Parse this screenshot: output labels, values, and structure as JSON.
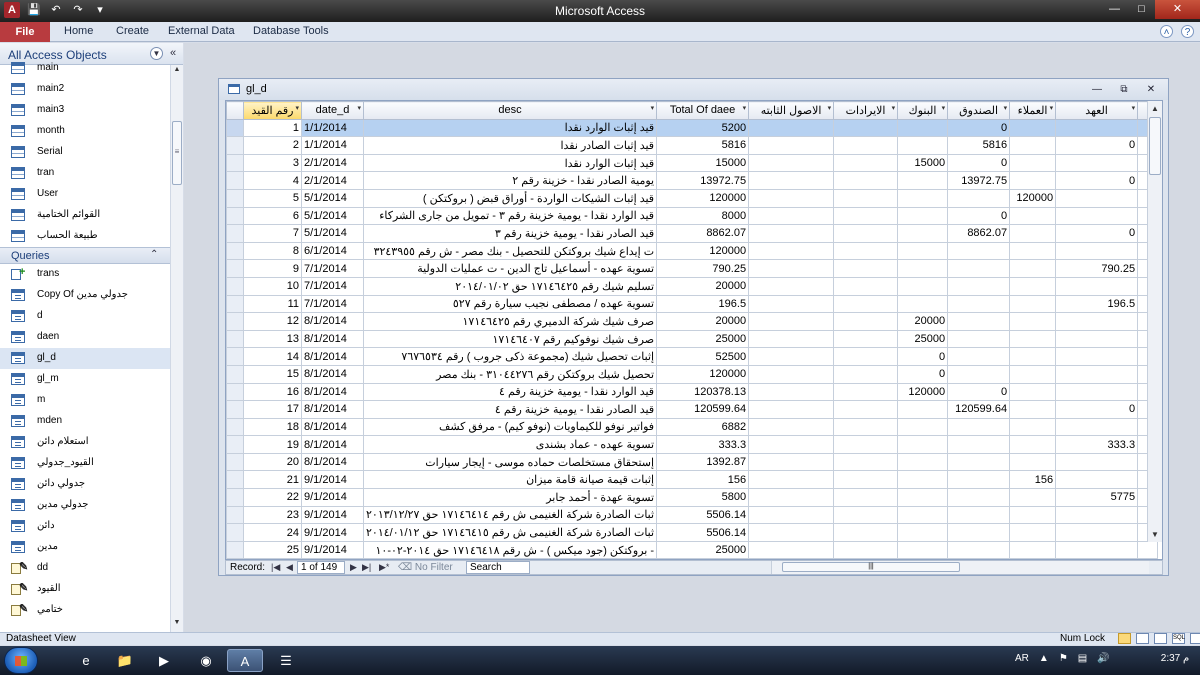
{
  "window": {
    "title": "Microsoft Access"
  },
  "ribbon": {
    "file": "File",
    "tabs": [
      "Home",
      "Create",
      "External Data",
      "Database Tools"
    ]
  },
  "nav": {
    "header": "All Access Objects",
    "tables": [
      "main",
      "main2",
      "main3",
      "month",
      "Serial",
      "tran",
      "User",
      "القوائم الختامية",
      "طبيعة الحساب"
    ],
    "queries_header": "Queries",
    "queries": [
      {
        "label": "trans",
        "kind": "append"
      },
      {
        "label": "Copy Of جدولي مدين",
        "kind": "select"
      },
      {
        "label": "d",
        "kind": "select"
      },
      {
        "label": "daen",
        "kind": "select"
      },
      {
        "label": "gl_d",
        "kind": "select",
        "selected": true
      },
      {
        "label": "gl_m",
        "kind": "select"
      },
      {
        "label": "m",
        "kind": "select"
      },
      {
        "label": "mden",
        "kind": "select"
      },
      {
        "label": "استعلام دائن",
        "kind": "select"
      },
      {
        "label": "القيود_جدولي",
        "kind": "select"
      },
      {
        "label": "جدولي دائن",
        "kind": "select"
      },
      {
        "label": "جدولي مدين",
        "kind": "select"
      },
      {
        "label": "دائن",
        "kind": "select"
      },
      {
        "label": "مدين",
        "kind": "select"
      },
      {
        "label": "dd",
        "kind": "update"
      },
      {
        "label": "القيود",
        "kind": "update"
      },
      {
        "label": "ختامي",
        "kind": "update"
      }
    ]
  },
  "doc": {
    "title": "gl_d",
    "columns": [
      "رقم القيد",
      "date_d",
      "desc",
      "Total Of daee",
      "الاصول الثابته",
      "الايرادات",
      "البنوك",
      "الصندوق",
      "العملاء",
      "العهد"
    ],
    "rows": [
      [
        "1",
        "1/1/2014",
        "قيد إثبات الوارد نقدا",
        "5200",
        "",
        "",
        "",
        "0",
        "",
        ""
      ],
      [
        "2",
        "1/1/2014",
        "قيد إثبات الصادر نقدا",
        "5816",
        "",
        "",
        "",
        "5816",
        "",
        "0"
      ],
      [
        "3",
        "2/1/2014",
        "قيد إثبات الوارد نقدا",
        "15000",
        "",
        "",
        "15000",
        "0",
        "",
        ""
      ],
      [
        "4",
        "2/1/2014",
        "يومية الصادر نقدا - خزينة رقم ٢",
        "13972.75",
        "",
        "",
        "",
        "13972.75",
        "",
        "0"
      ],
      [
        "5",
        "5/1/2014",
        "قيد إثبات الشيكات الواردة - أوراق قبض ( بروكتكن )",
        "120000",
        "",
        "",
        "",
        "",
        "120000",
        ""
      ],
      [
        "6",
        "5/1/2014",
        "قيد الوارد نقدا - يومية خزينة رقم ٣ - تمويل من جارى الشركاء",
        "8000",
        "",
        "",
        "",
        "0",
        "",
        ""
      ],
      [
        "7",
        "5/1/2014",
        "قيد الصادر نقدا - يومية خزينة رقم ٣",
        "8862.07",
        "",
        "",
        "",
        "8862.07",
        "",
        "0"
      ],
      [
        "8",
        "6/1/2014",
        "ت إيداع شيك بروكتكن للتحصيل - بنك مصر - ش رقم ٣٢٤٣٩٥٥",
        "120000",
        "",
        "",
        "",
        "",
        "",
        ""
      ],
      [
        "9",
        "7/1/2014",
        "تسوية عهده - أسماعيل تاج الدين - ت عمليات الدولية",
        "790.25",
        "",
        "",
        "",
        "",
        "",
        "790.25"
      ],
      [
        "10",
        "7/1/2014",
        "تسليم شيك رقم ١٧١٤٦٤٢٥ حق ٢٠١٤/٠١/٠٢",
        "20000",
        "",
        "",
        "",
        "",
        "",
        ""
      ],
      [
        "11",
        "7/1/2014",
        "تسوية عهده / مصطفى نجيب سيارة رقم ٥٢٧",
        "196.5",
        "",
        "",
        "",
        "",
        "",
        "196.5"
      ],
      [
        "12",
        "8/1/2014",
        "صرف شيك شركة الدميري رقم ١٧١٤٦٤٢٥",
        "20000",
        "",
        "",
        "20000",
        "",
        "",
        ""
      ],
      [
        "13",
        "8/1/2014",
        "صرف شيك نوفوكيم رقم ١٧١٤٦٤٠٧",
        "25000",
        "",
        "",
        "25000",
        "",
        "",
        ""
      ],
      [
        "14",
        "8/1/2014",
        "إثبات تحصيل شيك (مجموعة ذكى جروب ) رقم ٧٦٧٦٥٣٤",
        "52500",
        "",
        "",
        "0",
        "",
        "",
        ""
      ],
      [
        "15",
        "8/1/2014",
        "تحصيل شيك بروكتكن رقم ٣١٠٤٤٢٧٦ - بنك مصر",
        "120000",
        "",
        "",
        "0",
        "",
        "",
        ""
      ],
      [
        "16",
        "8/1/2014",
        "قيد الوارد نقدا - يومية خزينة رقم ٤",
        "120378.13",
        "",
        "",
        "120000",
        "0",
        "",
        ""
      ],
      [
        "17",
        "8/1/2014",
        "قيد الصادر نقدا - يومية خزينة رقم ٤",
        "120599.64",
        "",
        "",
        "",
        "120599.64",
        "",
        "0"
      ],
      [
        "18",
        "8/1/2014",
        "فواتير نوفو للكيماويات (نوفو كيم) - مرفق كشف",
        "6882",
        "",
        "",
        "",
        "",
        "",
        ""
      ],
      [
        "19",
        "8/1/2014",
        "تسوية عهده - عماد بشندى",
        "333.3",
        "",
        "",
        "",
        "",
        "",
        "333.3"
      ],
      [
        "20",
        "8/1/2014",
        "إستحقاق مستخلصات حماده موسى - إيجار سيارات",
        "1392.87",
        "",
        "",
        "",
        "",
        "",
        ""
      ],
      [
        "21",
        "9/1/2014",
        "إثبات قيمة صيانة قامة ميزان",
        "156",
        "",
        "",
        "",
        "",
        "156",
        ""
      ],
      [
        "22",
        "9/1/2014",
        "تسوية عهدة - أحمد جابر",
        "5800",
        "",
        "",
        "",
        "",
        "",
        "5775"
      ],
      [
        "23",
        "9/1/2014",
        "ثبات الصادرة شركة الغنيمى ش رقم ١٧١٤٦٤١٤ حق ٢٠١٣/١٢/٢٧",
        "5506.14",
        "",
        "",
        "",
        "",
        "",
        ""
      ],
      [
        "24",
        "9/1/2014",
        "ثبات الصادرة شركة الغنيمى ش رقم ١٧١٤٦٤١٥ حق ٢٠١٤/٠١/١٢",
        "5506.14",
        "",
        "",
        "",
        "",
        "",
        ""
      ],
      [
        "25",
        "9/1/2014",
        "- بروكتكن (جود ميكس ) - ش رقم ١٧١٤٦٤١٨ حق ٢٠١٤-٠٢-١٠",
        "25000",
        "",
        "",
        "",
        "",
        "",
        ""
      ]
    ]
  },
  "record_nav": {
    "label": "Record:",
    "position": "1 of 149",
    "filter": "No Filter",
    "search": "Search"
  },
  "status": {
    "view": "Datasheet View",
    "numlock": "Num Lock",
    "sql": "SQL"
  },
  "taskbar": {
    "lang": "AR",
    "time": "2:37 م"
  }
}
